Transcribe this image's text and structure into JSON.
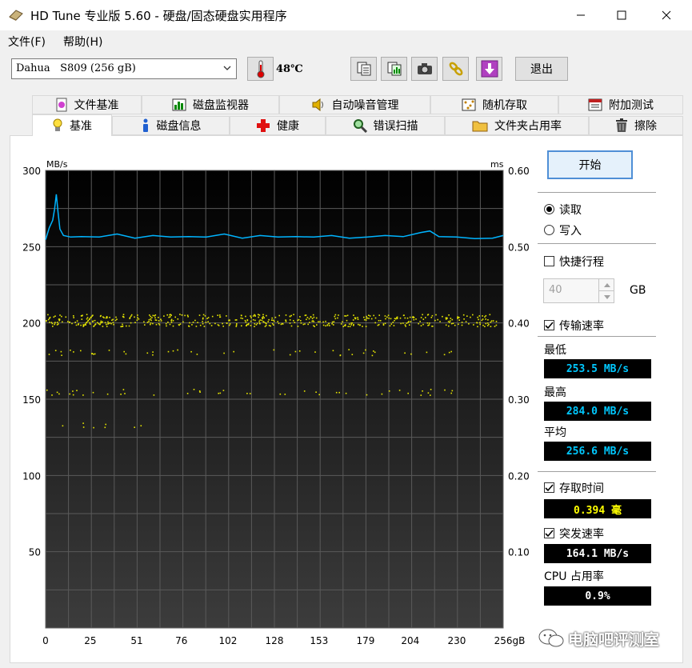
{
  "window": {
    "title": "HD Tune 专业版 5.60 - 硬盘/固态硬盘实用程序"
  },
  "menu": [
    "文件(F)",
    "帮助(H)"
  ],
  "toolbar": {
    "drive": "Dahua   S809 (256 gB)",
    "temperature": "48℃",
    "exit_label": "退出",
    "icons": [
      "copy-info-icon",
      "copy-screen-icon",
      "camera-icon",
      "chain-icon",
      "download-icon"
    ]
  },
  "tabs_top": [
    {
      "label": "文件基准",
      "icon": "file-benchmark-icon"
    },
    {
      "label": "磁盘监视器",
      "icon": "disk-monitor-icon"
    },
    {
      "label": "自动噪音管理",
      "icon": "speaker-icon"
    },
    {
      "label": "随机存取",
      "icon": "random-access-icon"
    },
    {
      "label": "附加测试",
      "icon": "extra-tests-icon"
    }
  ],
  "tabs_bottom": [
    {
      "label": "基准",
      "icon": "lightbulb-icon",
      "active": true
    },
    {
      "label": "磁盘信息",
      "icon": "info-icon"
    },
    {
      "label": "健康",
      "icon": "health-cross-icon"
    },
    {
      "label": "错误扫描",
      "icon": "magnifier-icon"
    },
    {
      "label": "文件夹占用率",
      "icon": "folder-icon"
    },
    {
      "label": "擦除",
      "icon": "trash-icon"
    }
  ],
  "controls": {
    "start_label": "开始",
    "read_label": "读取",
    "write_label": "写入",
    "mode": "read",
    "quick_label": "快捷行程",
    "quick_checked": false,
    "quick_value": "40",
    "quick_unit": "GB",
    "transfer_label": "传输速率",
    "transfer_checked": true,
    "min_label": "最低",
    "min_value": "253.5 MB/s",
    "max_label": "最高",
    "max_value": "284.0 MB/s",
    "avg_label": "平均",
    "avg_value": "256.6 MB/s",
    "access_label": "存取时间",
    "access_checked": true,
    "access_value": "0.394 毫",
    "burst_label": "突发速率",
    "burst_checked": true,
    "burst_value": "164.1 MB/s",
    "cpu_label": "CPU 占用率",
    "cpu_value": "0.9%"
  },
  "chart_data": {
    "type": "line",
    "left_axis_label": "MB/s",
    "right_axis_label": "ms",
    "ylim": [
      0,
      300
    ],
    "y2lim": [
      0,
      0.6
    ],
    "xlim": [
      0,
      256
    ],
    "left_ticks": [
      "300",
      "250",
      "200",
      "150",
      "100",
      "50"
    ],
    "left_tick_values": [
      300,
      250,
      200,
      150,
      100,
      50
    ],
    "right_ticks": [
      "0.60",
      "0.50",
      "0.40",
      "0.30",
      "0.20",
      "0.10"
    ],
    "right_tick_values": [
      0.6,
      0.5,
      0.4,
      0.3,
      0.2,
      0.1
    ],
    "x_ticks": [
      "0",
      "25",
      "51",
      "76",
      "102",
      "128",
      "153",
      "179",
      "204",
      "230",
      "256gB"
    ],
    "x_tick_values": [
      0,
      25,
      51,
      76,
      102,
      128,
      153,
      179,
      204,
      230,
      256
    ],
    "grid": true,
    "series": [
      {
        "kind": "transfer-rate",
        "color": "#00b4ff",
        "x": [
          0,
          2,
          4,
          5,
          6,
          7,
          8,
          10,
          14,
          20,
          30,
          40,
          50,
          60,
          70,
          80,
          90,
          100,
          110,
          120,
          130,
          140,
          150,
          160,
          170,
          180,
          190,
          200,
          210,
          215,
          220,
          230,
          240,
          250,
          256
        ],
        "y": [
          255,
          262,
          267,
          275,
          284,
          272,
          262,
          257,
          256,
          257,
          256,
          258,
          256,
          257,
          256,
          257,
          256,
          258,
          256,
          257,
          256,
          257,
          256,
          257,
          256,
          256,
          257,
          257,
          259,
          260,
          257,
          256,
          255,
          256,
          257
        ]
      },
      {
        "kind": "access-time",
        "color": "#e6e600",
        "bands_ms": [
          0.404,
          0.362,
          0.31,
          0.266
        ],
        "band_end_x": [
          254,
          230,
          230,
          80
        ]
      }
    ]
  },
  "watermark": "电脑吧评测室"
}
